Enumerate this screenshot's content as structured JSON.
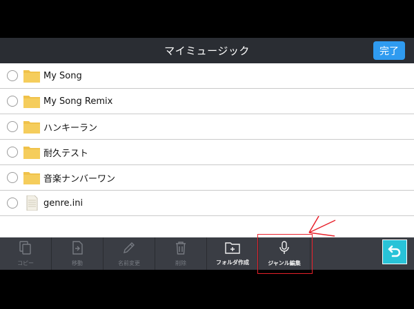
{
  "header": {
    "title": "マイミュージック",
    "done_label": "完了"
  },
  "files": [
    {
      "label": "My Song",
      "type": "folder"
    },
    {
      "label": "My Song Remix",
      "type": "folder"
    },
    {
      "label": "ハンキーラン",
      "type": "folder"
    },
    {
      "label": "耐久テスト",
      "type": "folder"
    },
    {
      "label": "音楽ナンバーワン",
      "type": "folder"
    },
    {
      "label": "genre.ini",
      "type": "file"
    }
  ],
  "toolbar": {
    "copy_label": "コピー",
    "move_label": "移動",
    "rename_label": "名前変更",
    "delete_label": "削除",
    "new_folder_label": "フォルダ作成",
    "genre_edit_label": "ジャンル編集"
  },
  "colors": {
    "header_bg": "#2a2d33",
    "accent_blue": "#2f9bf0",
    "folder_yellow": "#f0c24a",
    "back_cyan": "#28c3d8",
    "annotation_red": "#e8202a"
  }
}
